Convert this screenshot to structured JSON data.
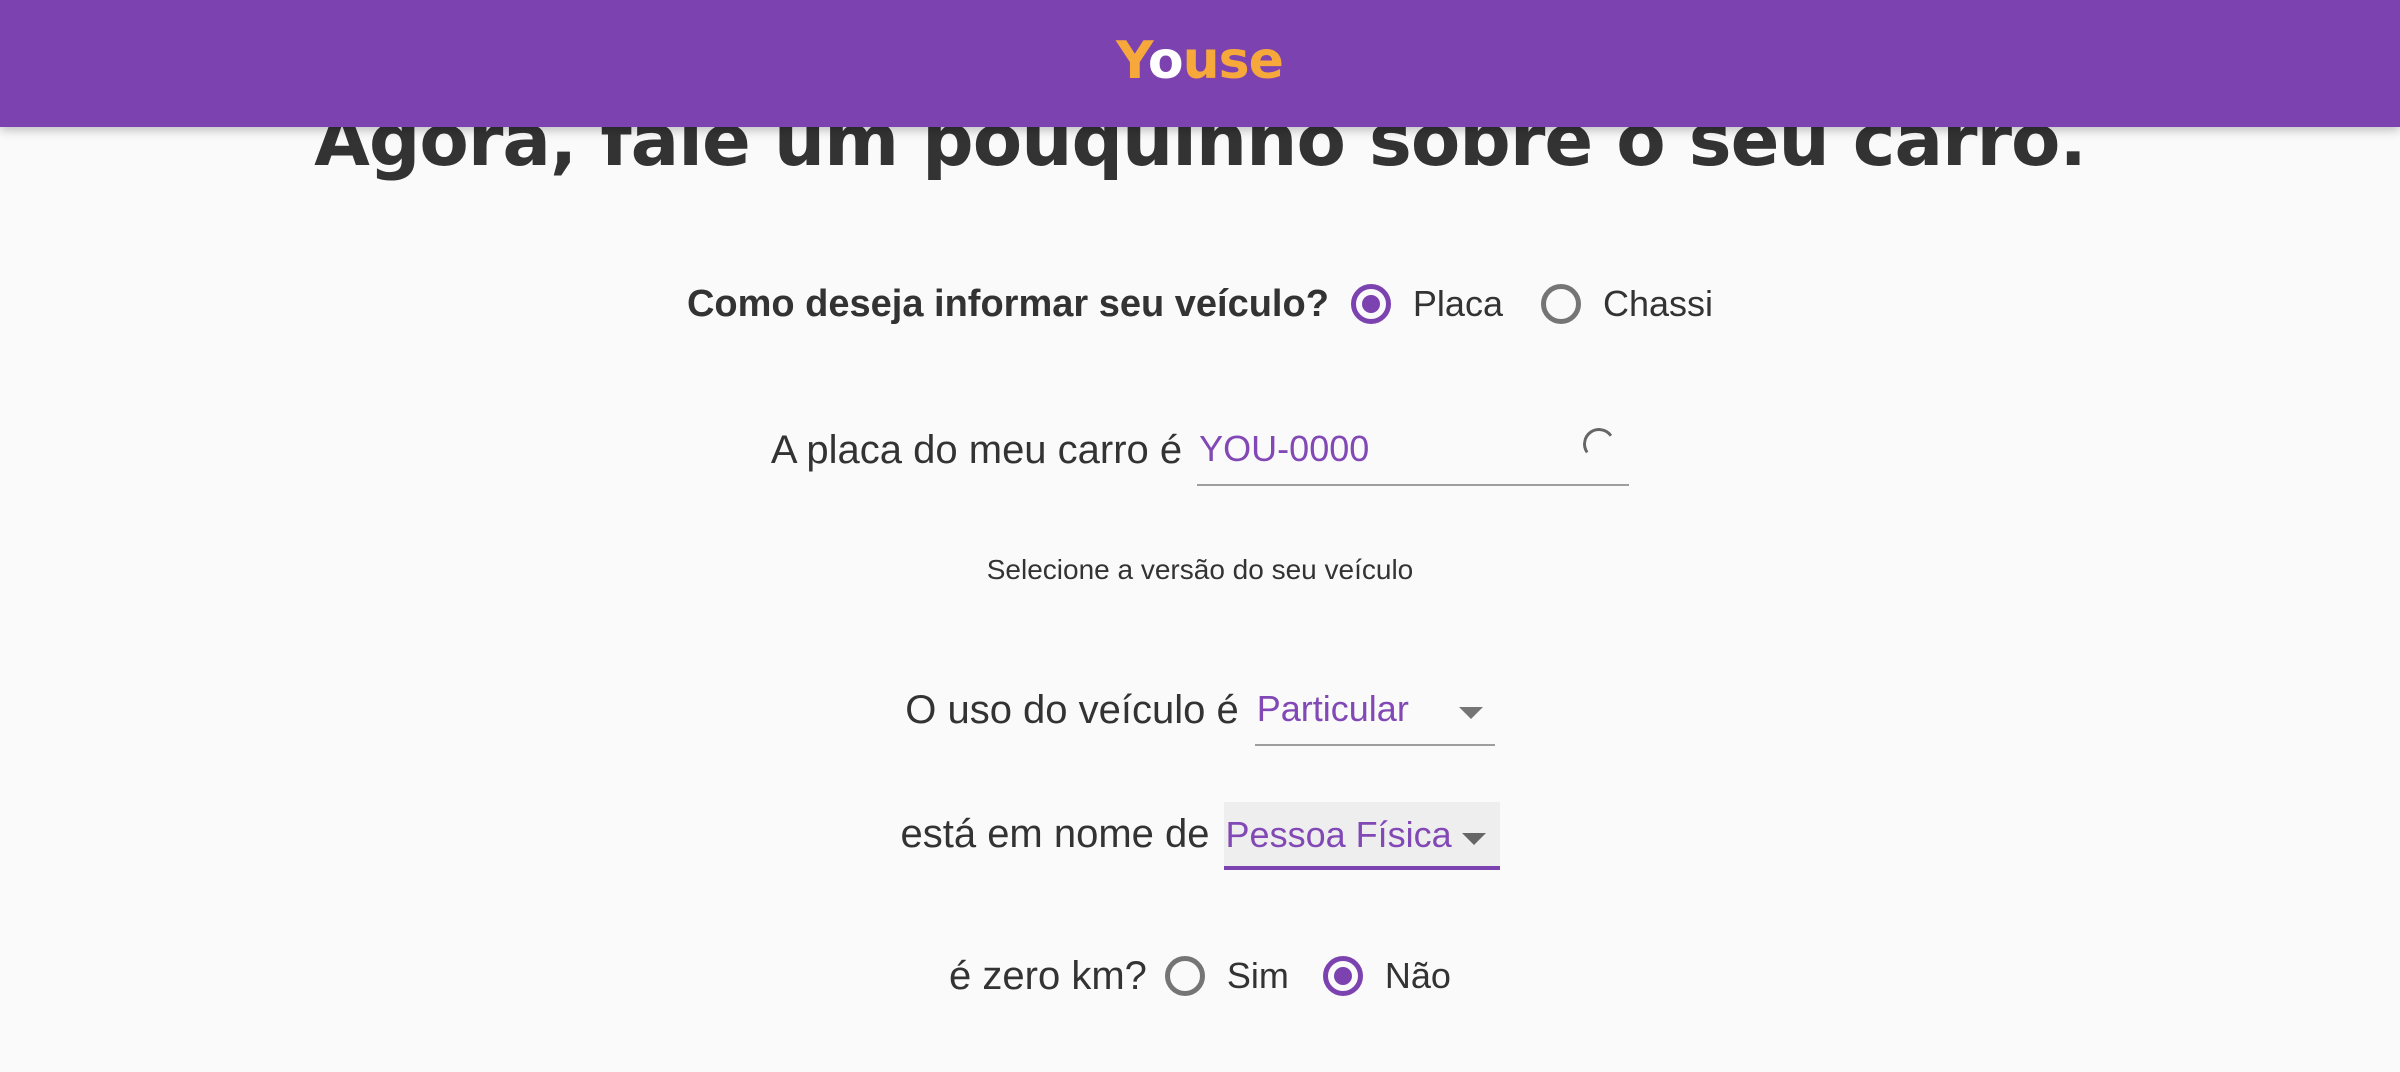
{
  "header": {
    "logo_text_pre": "Y",
    "logo_text_o": "o",
    "logo_text_post": "use",
    "brand_color": "#7c42b0",
    "logo_color": "#f7a83b"
  },
  "main": {
    "heading": "Agora, fale um pouquinho sobre o seu carro.",
    "vehicle_question": {
      "label": "Como deseja informar seu veículo?",
      "options": [
        {
          "label": "Placa",
          "selected": true
        },
        {
          "label": "Chassi",
          "selected": false
        }
      ]
    },
    "plate": {
      "label": "A placa do meu carro é",
      "value": "YOU-0000",
      "loading_icon": "spinner-icon"
    },
    "version_hint": "Selecione a versão do seu veículo",
    "usage": {
      "label": "O uso do veículo é",
      "selected": "Particular"
    },
    "owner": {
      "label": "está em nome de",
      "selected": "Pessoa Física"
    },
    "zero_km": {
      "label": "é zero km?",
      "options": [
        {
          "label": "Sim",
          "selected": false
        },
        {
          "label": "Não",
          "selected": true
        }
      ]
    }
  }
}
